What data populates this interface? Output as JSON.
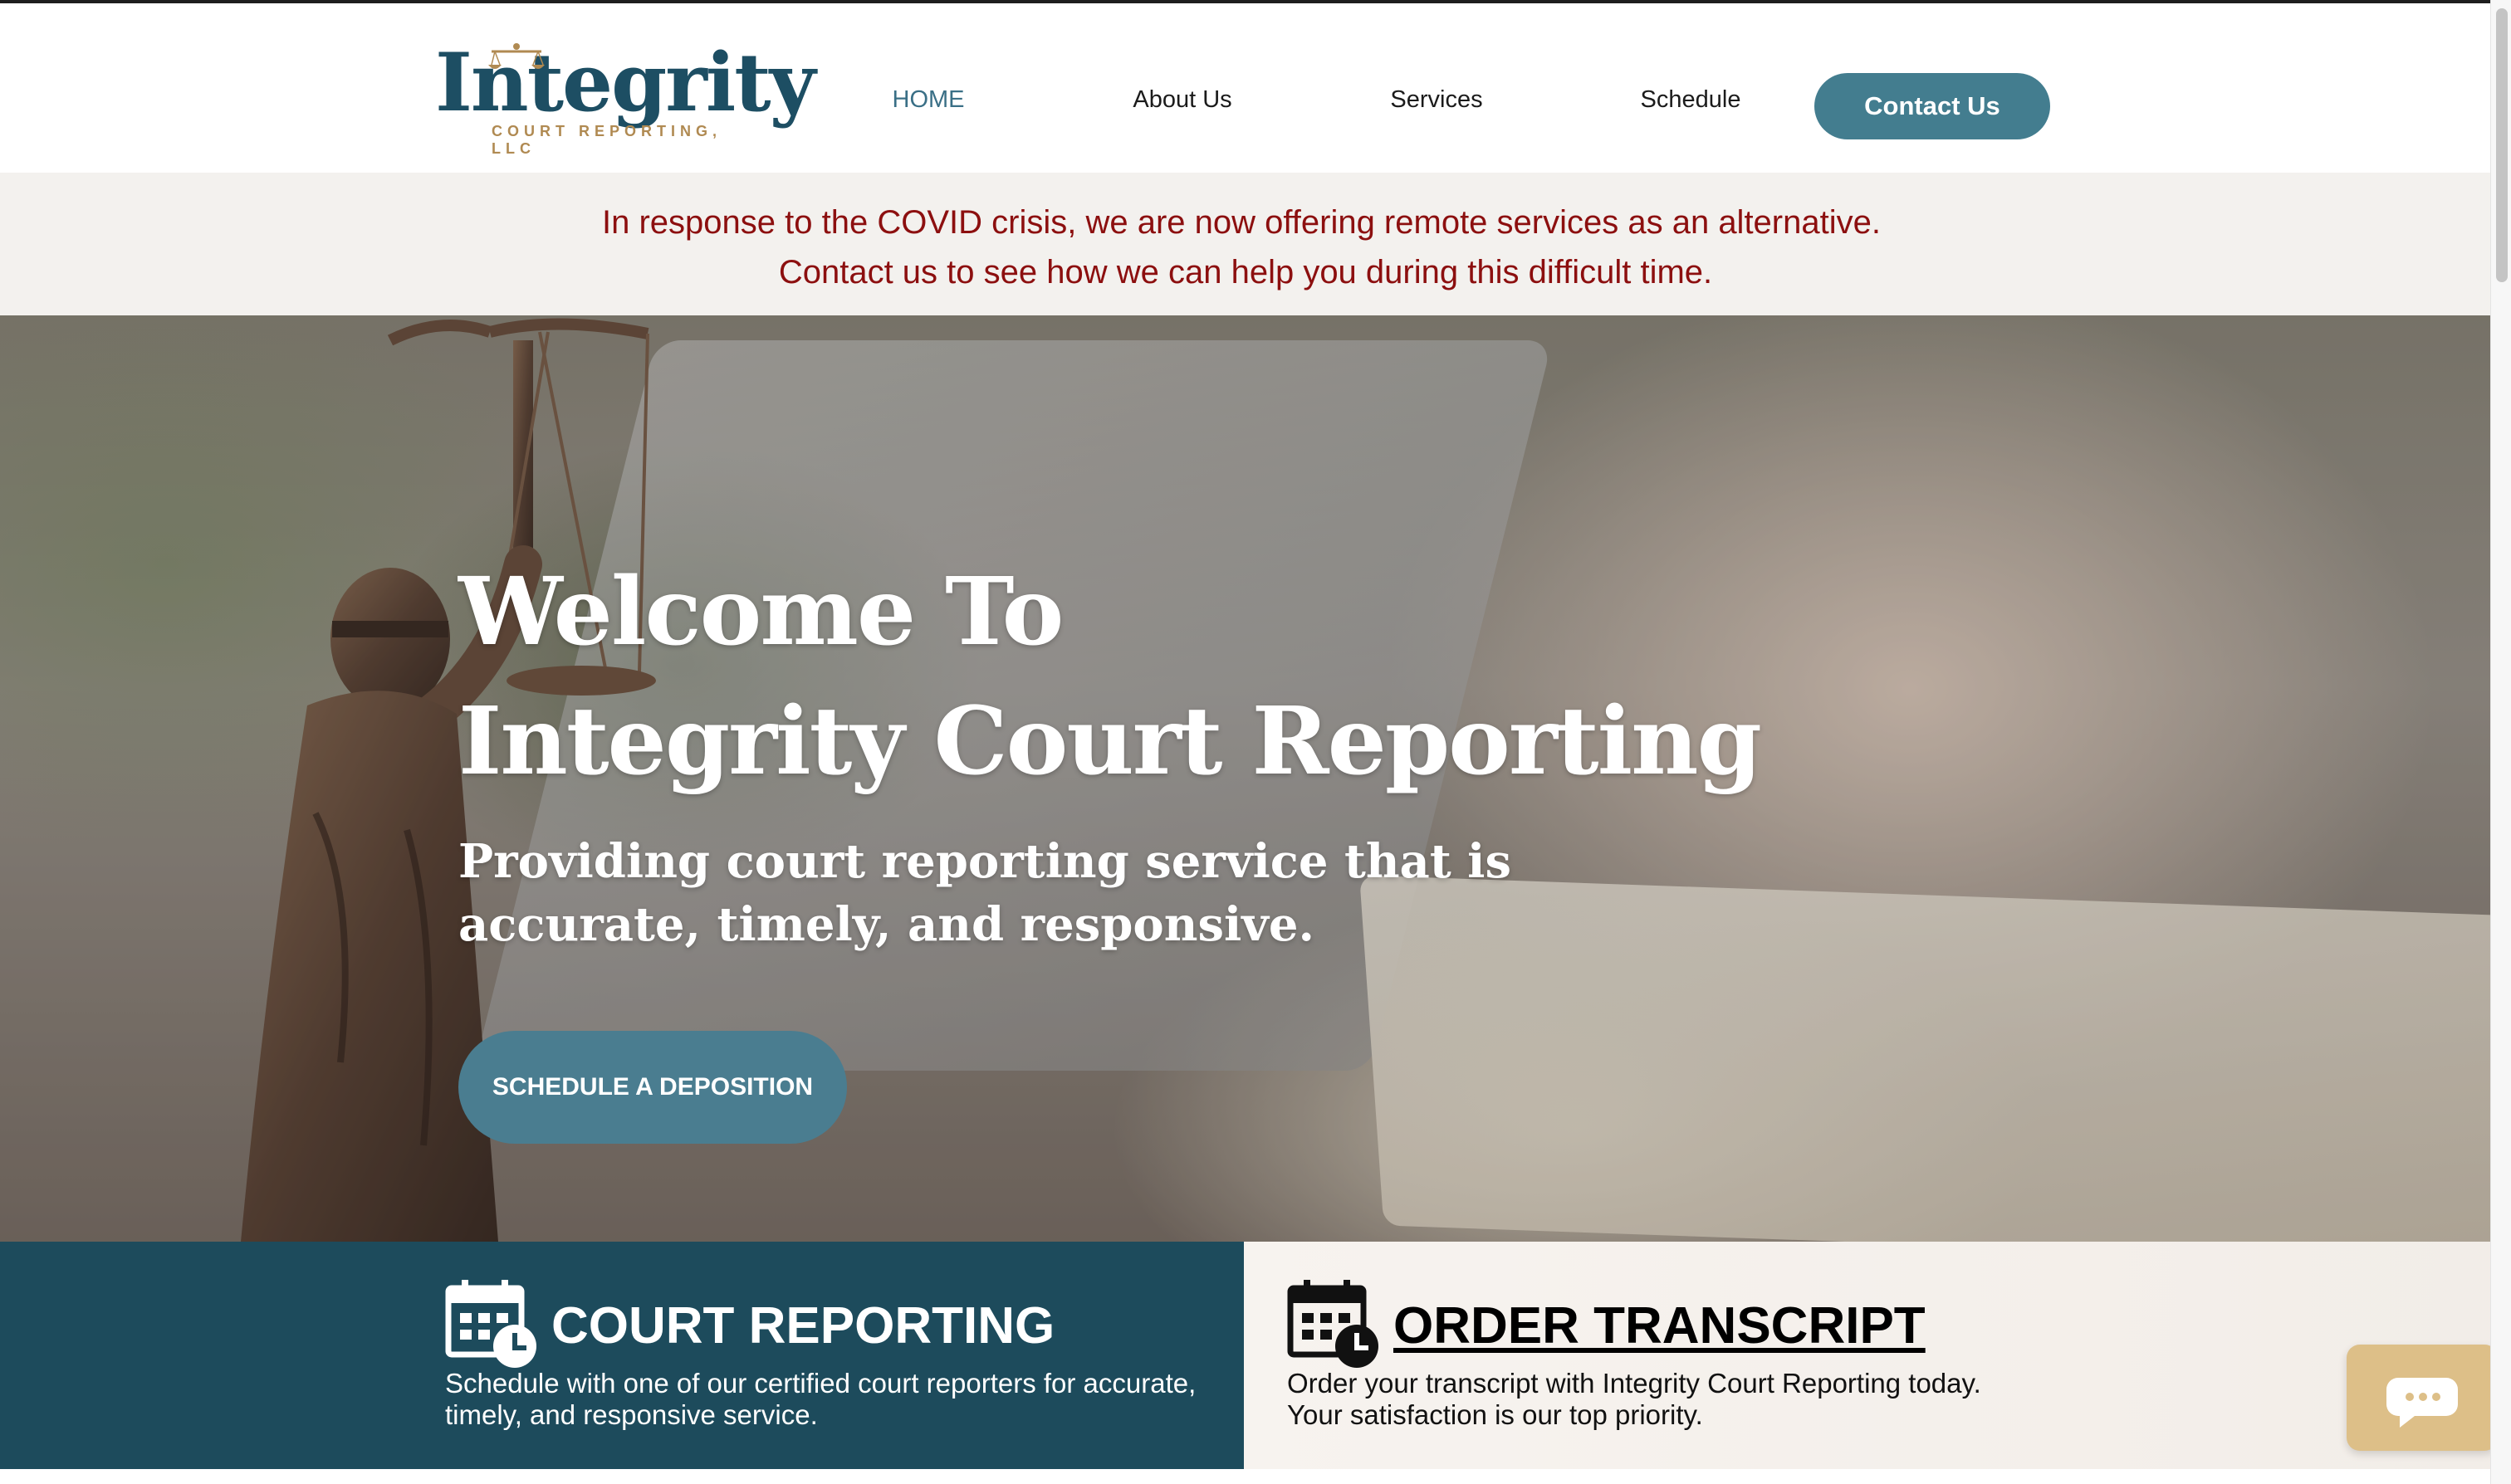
{
  "logo": {
    "word": "Integrity",
    "subtitle": "COURT REPORTING, LLC"
  },
  "nav": {
    "items": [
      {
        "label": "HOME",
        "active": true
      },
      {
        "label": "About Us",
        "active": false
      },
      {
        "label": "Services",
        "active": false
      },
      {
        "label": "Schedule",
        "active": false
      }
    ],
    "contact_label": "Contact Us"
  },
  "banner": {
    "line1": "In response to the COVID crisis, we are now offering remote services as an alternative.",
    "line2": "Contact us to see how we can help you during this difficult time."
  },
  "hero": {
    "title_line1": "Welcome To",
    "title_line2": "Integrity Court Reporting",
    "subtitle_line1": "Providing court reporting service that is",
    "subtitle_line2": "accurate, timely, and responsive.",
    "button_label": "SCHEDULE A DEPOSITION"
  },
  "panels": {
    "court_reporting": {
      "title": "COURT REPORTING",
      "text_line1": "Schedule with one of our certified court reporters for accurate,",
      "text_line2": "timely, and responsive service.",
      "icon": "calendar-clock-icon"
    },
    "order_transcript": {
      "title": "ORDER TRANSCRIPT",
      "text_line1": "Order your transcript with Integrity Court Reporting today.",
      "text_line2": "Your satisfaction is our top priority.",
      "icon": "calendar-clock-icon"
    }
  },
  "chat": {
    "icon": "chat-bubble-icon"
  },
  "colors": {
    "brand_dark": "#1d4b5c",
    "brand_button": "#437d8f",
    "banner_text": "#8c0f0f",
    "logo_gold": "#b08a52",
    "chat_widget": "#ddbf88"
  }
}
